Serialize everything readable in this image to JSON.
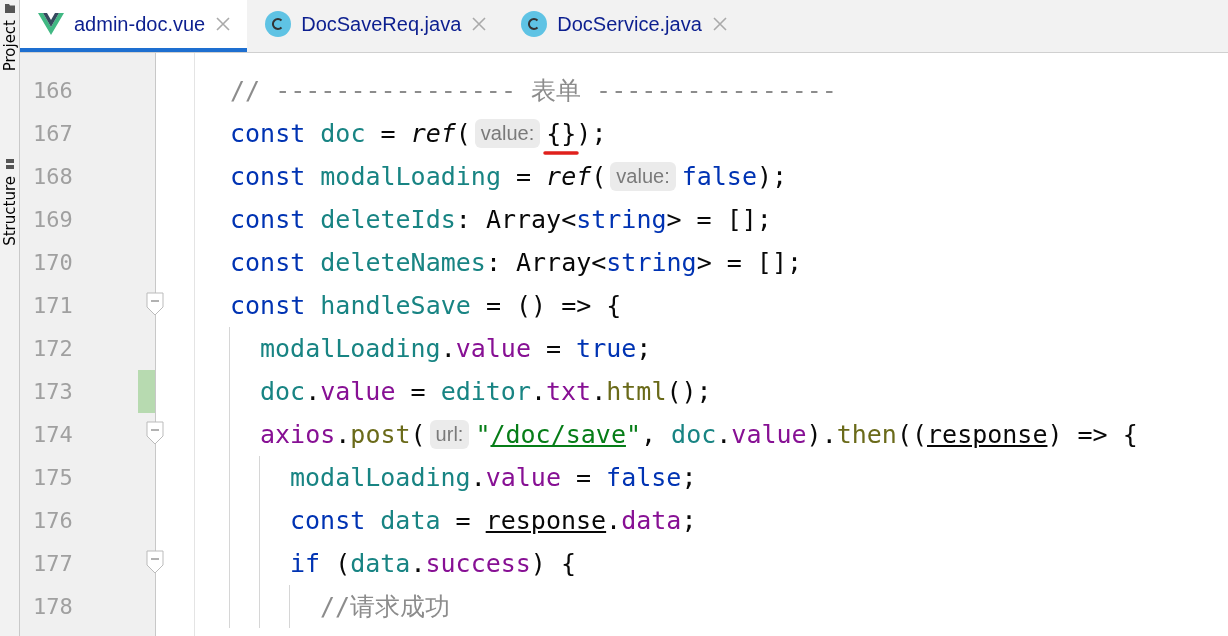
{
  "side_tabs": [
    {
      "label": "Project",
      "kind": "folder"
    },
    {
      "label": "Structure",
      "kind": "structure"
    }
  ],
  "tabs": [
    {
      "label": "admin-doc.vue",
      "kind": "vue",
      "selected": true
    },
    {
      "label": "DocSaveReq.java",
      "kind": "class",
      "selected": false
    },
    {
      "label": "DocService.java",
      "kind": "class",
      "selected": false
    }
  ],
  "lines": [
    {
      "number": "166",
      "changed": false,
      "fold": false,
      "tokens": [
        {
          "t": "// ---------------- 表单 ----------------",
          "kind": "comment"
        }
      ]
    },
    {
      "number": "167",
      "changed": false,
      "fold": false,
      "tokens": [
        {
          "t": "const ",
          "kind": "keyword"
        },
        {
          "t": "doc",
          "kind": "local"
        },
        {
          "t": " = ",
          "kind": "plain"
        },
        {
          "t": "ref",
          "kind": "call"
        },
        {
          "t": "(",
          "kind": "plain"
        },
        {
          "t": "value:",
          "kind": "hint"
        },
        {
          "t": "{}",
          "kind": "error"
        },
        {
          "t": ");",
          "kind": "plain"
        }
      ]
    },
    {
      "number": "168",
      "changed": false,
      "fold": false,
      "tokens": [
        {
          "t": "const ",
          "kind": "keyword"
        },
        {
          "t": "modalLoading",
          "kind": "local"
        },
        {
          "t": " = ",
          "kind": "plain"
        },
        {
          "t": "ref",
          "kind": "call"
        },
        {
          "t": "(",
          "kind": "plain"
        },
        {
          "t": "value:",
          "kind": "hint"
        },
        {
          "t": "false",
          "kind": "keyword"
        },
        {
          "t": ");",
          "kind": "plain"
        }
      ]
    },
    {
      "number": "169",
      "changed": false,
      "fold": false,
      "tokens": [
        {
          "t": "const ",
          "kind": "keyword"
        },
        {
          "t": "deleteIds",
          "kind": "local"
        },
        {
          "t": ": Array<",
          "kind": "plain"
        },
        {
          "t": "string",
          "kind": "keyword"
        },
        {
          "t": "> = [];",
          "kind": "plain"
        }
      ]
    },
    {
      "number": "170",
      "changed": false,
      "fold": false,
      "tokens": [
        {
          "t": "const ",
          "kind": "keyword"
        },
        {
          "t": "deleteNames",
          "kind": "local"
        },
        {
          "t": ": Array<",
          "kind": "plain"
        },
        {
          "t": "string",
          "kind": "keyword"
        },
        {
          "t": "> = [];",
          "kind": "plain"
        }
      ]
    },
    {
      "number": "171",
      "changed": false,
      "fold": true,
      "tokens": [
        {
          "t": "const ",
          "kind": "keyword"
        },
        {
          "t": "handleSave",
          "kind": "local"
        },
        {
          "t": " = () => {",
          "kind": "plain"
        }
      ],
      "children": [
        {
          "number": "172",
          "changed": false,
          "fold": false,
          "tokens": [
            {
              "t": "modalLoading",
              "kind": "local"
            },
            {
              "t": ".",
              "kind": "plain"
            },
            {
              "t": "value",
              "kind": "property"
            },
            {
              "t": " = ",
              "kind": "plain"
            },
            {
              "t": "true",
              "kind": "keyword"
            },
            {
              "t": ";",
              "kind": "plain"
            }
          ]
        },
        {
          "number": "173",
          "changed": true,
          "fold": false,
          "tokens": [
            {
              "t": "doc",
              "kind": "local"
            },
            {
              "t": ".",
              "kind": "plain"
            },
            {
              "t": "value",
              "kind": "property"
            },
            {
              "t": " = ",
              "kind": "plain"
            },
            {
              "t": "editor",
              "kind": "local"
            },
            {
              "t": ".",
              "kind": "plain"
            },
            {
              "t": "txt",
              "kind": "property"
            },
            {
              "t": ".",
              "kind": "plain"
            },
            {
              "t": "html",
              "kind": "method"
            },
            {
              "t": "();",
              "kind": "plain"
            }
          ]
        },
        {
          "number": "174",
          "changed": false,
          "fold": true,
          "tokens": [
            {
              "t": "axios",
              "kind": "property"
            },
            {
              "t": ".",
              "kind": "plain"
            },
            {
              "t": "post",
              "kind": "method"
            },
            {
              "t": "(",
              "kind": "plain"
            },
            {
              "t": "url:",
              "kind": "hint"
            },
            {
              "t": "\"",
              "kind": "string"
            },
            {
              "t": "/doc/save",
              "kind": "link"
            },
            {
              "t": "\"",
              "kind": "string"
            },
            {
              "t": ", ",
              "kind": "plain"
            },
            {
              "t": "doc",
              "kind": "local"
            },
            {
              "t": ".",
              "kind": "plain"
            },
            {
              "t": "value",
              "kind": "property"
            },
            {
              "t": ").",
              "kind": "plain"
            },
            {
              "t": "then",
              "kind": "method"
            },
            {
              "t": "((",
              "kind": "plain"
            },
            {
              "t": "response",
              "kind": "param"
            },
            {
              "t": ") => {",
              "kind": "plain"
            }
          ],
          "children": [
            {
              "number": "175",
              "changed": false,
              "fold": false,
              "tokens": [
                {
                  "t": "modalLoading",
                  "kind": "local"
                },
                {
                  "t": ".",
                  "kind": "plain"
                },
                {
                  "t": "value",
                  "kind": "property"
                },
                {
                  "t": " = ",
                  "kind": "plain"
                },
                {
                  "t": "false",
                  "kind": "keyword"
                },
                {
                  "t": ";",
                  "kind": "plain"
                }
              ]
            },
            {
              "number": "176",
              "changed": false,
              "fold": false,
              "tokens": [
                {
                  "t": "const ",
                  "kind": "keyword"
                },
                {
                  "t": "data",
                  "kind": "local"
                },
                {
                  "t": " = ",
                  "kind": "plain"
                },
                {
                  "t": "response",
                  "kind": "param"
                },
                {
                  "t": ".",
                  "kind": "plain"
                },
                {
                  "t": "data",
                  "kind": "property"
                },
                {
                  "t": ";",
                  "kind": "plain"
                }
              ]
            },
            {
              "number": "177",
              "changed": false,
              "fold": true,
              "tokens": [
                {
                  "t": "if",
                  "kind": "keyword"
                },
                {
                  "t": " (",
                  "kind": "plain"
                },
                {
                  "t": "data",
                  "kind": "local"
                },
                {
                  "t": ".",
                  "kind": "plain"
                },
                {
                  "t": "success",
                  "kind": "property"
                },
                {
                  "t": ") {",
                  "kind": "plain"
                }
              ],
              "children": [
                {
                  "number": "178",
                  "changed": false,
                  "fold": false,
                  "tokens": [
                    {
                      "t": "//请求成功",
                      "kind": "comment"
                    }
                  ]
                }
              ]
            }
          ]
        }
      ]
    }
  ]
}
